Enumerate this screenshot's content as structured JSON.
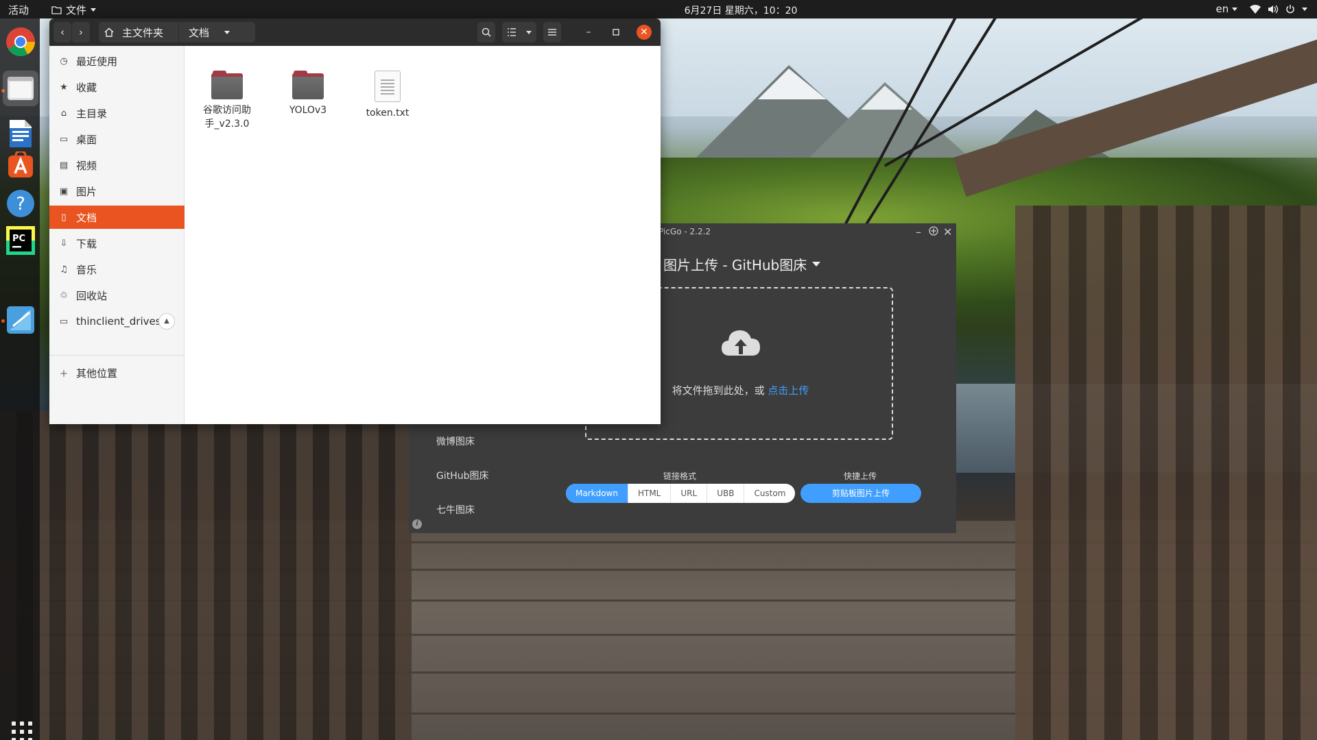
{
  "topbar": {
    "activities": "活动",
    "app_menu": "文件",
    "clock": "6月27日 星期六，10：20",
    "lang": "en"
  },
  "dock": {
    "apps": [
      "chrome-icon",
      "files-icon",
      "writer-icon",
      "software-icon",
      "help-icon",
      "pycharm-icon",
      "picgo-icon"
    ],
    "show_apps_icon": "apps-grid-icon"
  },
  "file_manager": {
    "path": [
      "主文件夹",
      "文档"
    ],
    "sidebar": [
      {
        "label": "最近使用",
        "icon": "clock-icon"
      },
      {
        "label": "收藏",
        "icon": "star-icon"
      },
      {
        "label": "主目录",
        "icon": "home-icon"
      },
      {
        "label": "桌面",
        "icon": "desktop-icon"
      },
      {
        "label": "视频",
        "icon": "video-icon"
      },
      {
        "label": "图片",
        "icon": "picture-icon"
      },
      {
        "label": "文档",
        "icon": "document-icon",
        "selected": true
      },
      {
        "label": "下载",
        "icon": "download-icon"
      },
      {
        "label": "音乐",
        "icon": "music-icon"
      },
      {
        "label": "回收站",
        "icon": "trash-icon"
      },
      {
        "label": "thinclient_drives",
        "icon": "drive-icon"
      },
      {
        "label": "其他位置",
        "icon": "plus-icon"
      }
    ],
    "files": [
      {
        "name": "谷歌访问助\n手_v2.3.0",
        "type": "folder"
      },
      {
        "name": "YOLOv3",
        "type": "folder"
      },
      {
        "name": "token.txt",
        "type": "text"
      }
    ],
    "accent_color": "#e95420"
  },
  "picgo": {
    "window_title": "PicGo - 2.2.2",
    "title": "图片上传 - GitHub图床",
    "drop_text": "将文件拖到此处，或",
    "drop_link": "点击上传",
    "side_items": [
      "微博图床",
      "GitHub图床",
      "七牛图床"
    ],
    "link_format_label": "链接格式",
    "formats": [
      "Markdown",
      "HTML",
      "URL",
      "UBB",
      "Custom"
    ],
    "selected_format": "Markdown",
    "quick_upload_label": "快捷上传",
    "quick_upload_button": "剪贴板图片上传",
    "accent_color": "#409eff"
  }
}
